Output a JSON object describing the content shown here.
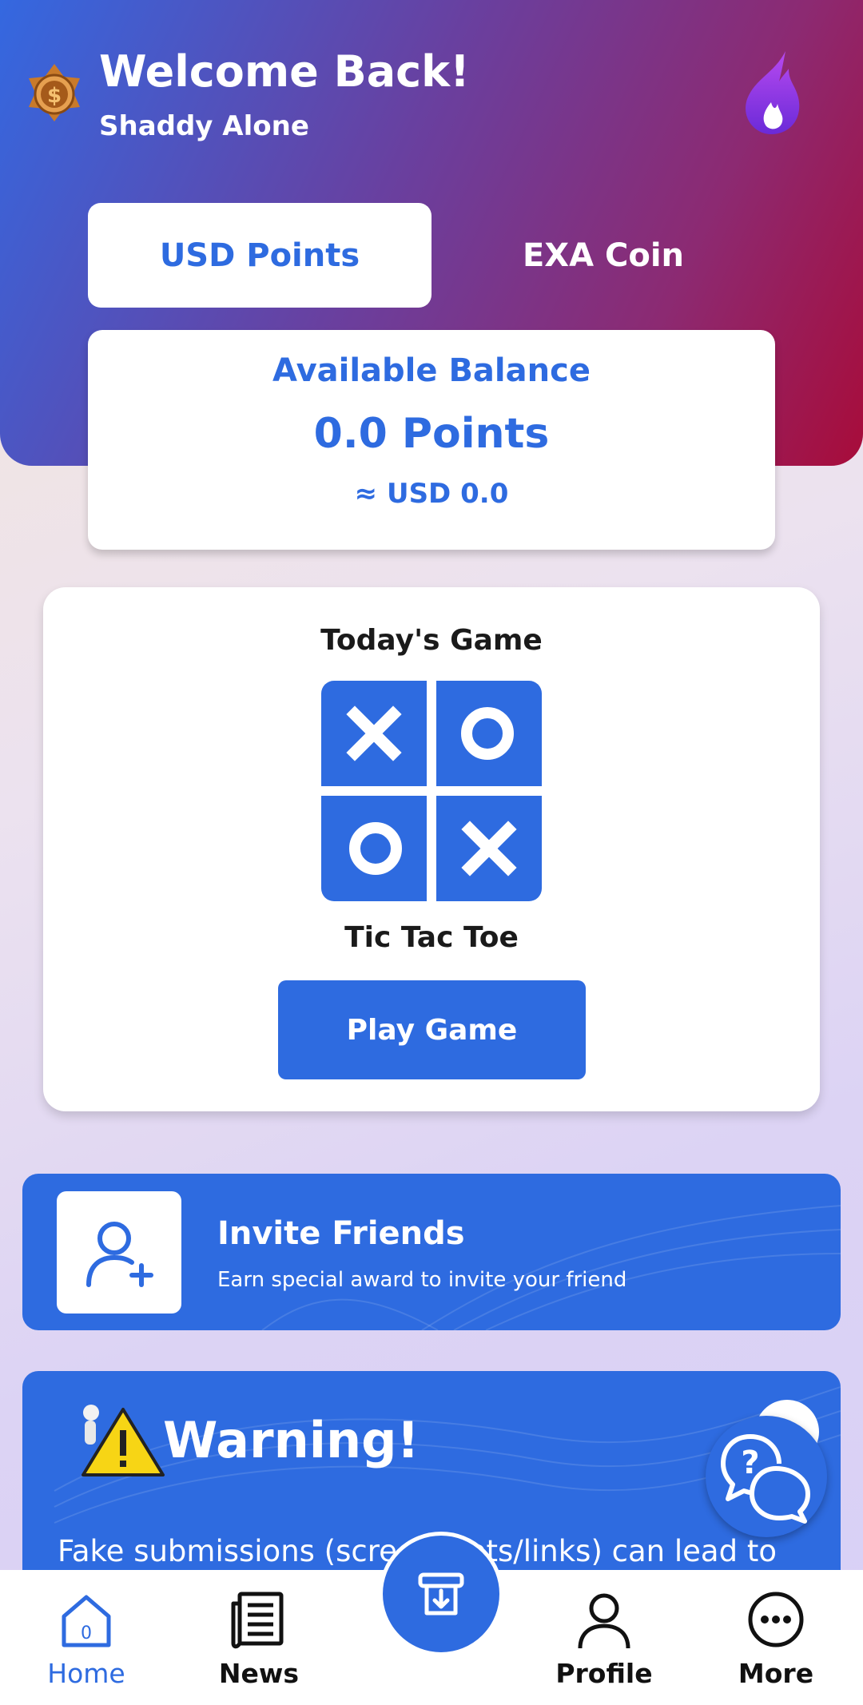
{
  "header": {
    "welcome": "Welcome Back!",
    "username": "Shaddy Alone"
  },
  "tabs": {
    "usd_points": "USD Points",
    "exa_coin": "EXA Coin"
  },
  "balance": {
    "label": "Available Balance",
    "points": "0.0 Points",
    "usd": "≈ USD 0.0"
  },
  "game": {
    "heading": "Today's Game",
    "name": "Tic Tac Toe",
    "play_label": "Play Game"
  },
  "invite": {
    "title": "Invite Friends",
    "subtitle": "Earn special award to invite your friend"
  },
  "warning": {
    "title": "Warning!",
    "text": "Fake submissions (screenshots/links) can lead to"
  },
  "nav": {
    "home": "Home",
    "news": "News",
    "profile": "Profile",
    "more": "More",
    "home_badge": "0"
  },
  "colors": {
    "accent": "#2e6be0",
    "header_start": "#3468e0",
    "header_end": "#a80c3a"
  },
  "icons": [
    "medal-icon",
    "flame-icon",
    "tic-tac-toe-icon",
    "add-user-icon",
    "warning-icon",
    "help-chat-icon",
    "home-icon",
    "news-icon",
    "withdraw-icon",
    "profile-icon",
    "more-icon"
  ]
}
